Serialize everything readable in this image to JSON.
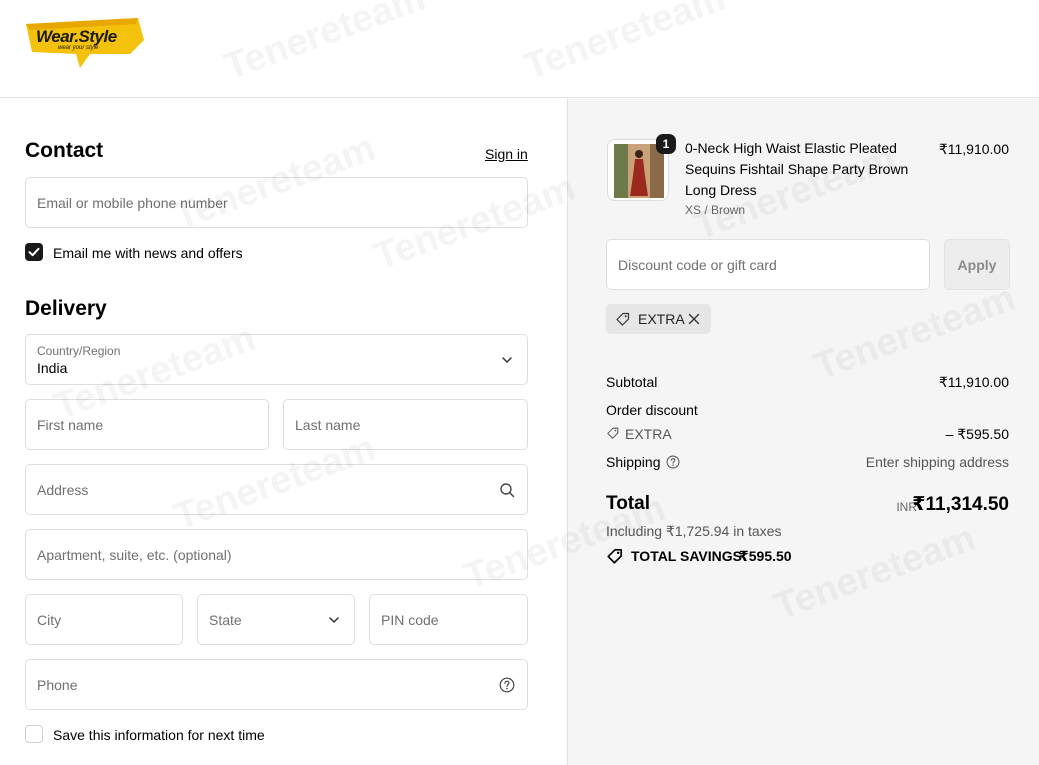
{
  "brand": {
    "name": "Wear.Style",
    "tagline": "wear your style",
    "accent": "#f4c10d"
  },
  "watermark": "Tenereteam",
  "contact": {
    "heading": "Contact",
    "sign_in": "Sign in",
    "email_placeholder": "Email or mobile phone number",
    "news_checkbox_label": "Email me with news and offers",
    "news_checked": true
  },
  "delivery": {
    "heading": "Delivery",
    "country_label": "Country/Region",
    "country_value": "India",
    "first_name_placeholder": "First name",
    "last_name_placeholder": "Last name",
    "address_placeholder": "Address",
    "apartment_placeholder": "Apartment, suite, etc. (optional)",
    "city_placeholder": "City",
    "state_placeholder": "State",
    "pin_placeholder": "PIN code",
    "phone_placeholder": "Phone",
    "save_info_label": "Save this information for next time",
    "save_info_checked": false
  },
  "summary": {
    "product": {
      "title": "0-Neck High Waist Elastic Pleated Sequins Fishtail Shape Party Brown Long Dress",
      "variant": "XS / Brown",
      "price": "₹11,910.00",
      "quantity": "1"
    },
    "discount_placeholder": "Discount code or gift card",
    "apply_label": "Apply",
    "applied_code": "EXTRA",
    "subtotal_label": "Subtotal",
    "subtotal_value": "₹11,910.00",
    "order_discount_label": "Order discount",
    "discount_code_label": "EXTRA",
    "discount_value": "– ₹595.50",
    "shipping_label": "Shipping",
    "shipping_value": "Enter shipping address",
    "total_label": "Total",
    "currency": "INR",
    "total_value": "₹11,314.50",
    "taxes_note": "Including ₹1,725.94 in taxes",
    "savings_label": "TOTAL SAVINGS",
    "savings_value": "₹595.50"
  }
}
